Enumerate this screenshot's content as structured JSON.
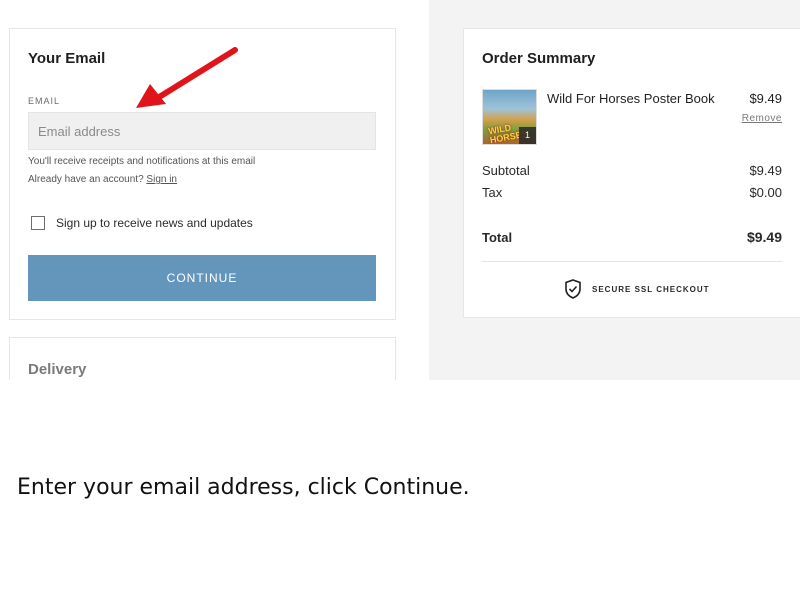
{
  "email_section": {
    "title": "Your Email",
    "field_label": "EMAIL",
    "email_placeholder": "Email address",
    "email_value": "",
    "hint_receipts": "You'll receive receipts and notifications at this email",
    "hint_account_prefix": "Already have an account?",
    "sign_in_label": "Sign in",
    "newsletter_label": "Sign up to receive news and updates",
    "newsletter_checked": false,
    "continue_label": "CONTINUE"
  },
  "delivery_section": {
    "title": "Delivery"
  },
  "order_summary": {
    "title": "Order Summary",
    "items": [
      {
        "name": "Wild For Horses Poster Book",
        "price": "$9.49",
        "quantity": "1",
        "remove_label": "Remove",
        "cover_text_line1": "WILD",
        "cover_text_line2": "HORSES"
      }
    ],
    "subtotal_label": "Subtotal",
    "subtotal_value": "$9.49",
    "tax_label": "Tax",
    "tax_value": "$0.00",
    "total_label": "Total",
    "total_value": "$9.49",
    "secure_label": "SECURE SSL CHECKOUT"
  },
  "instruction_caption": "Enter your email address, click Continue.",
  "colors": {
    "continue_button": "#6496bc",
    "annotation_arrow": "#e0141b",
    "summary_background": "#f3f3f3"
  },
  "icons": {
    "annotation_arrow": "red-arrow-icon",
    "secure": "shield-check-icon",
    "checkbox": "checkbox-icon"
  }
}
